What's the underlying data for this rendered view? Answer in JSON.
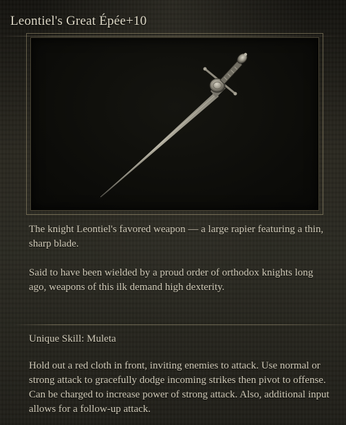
{
  "item": {
    "name": "Leontiel's Great Épée+10",
    "image_icon": "great-epee-weapon-icon"
  },
  "description": {
    "paragraph_1": "The knight Leontiel's favored weapon — a large rapier featuring a thin, sharp blade.",
    "paragraph_2": "Said to have been wielded by a proud order of orthodox knights long ago, weapons of this ilk demand high dexterity."
  },
  "skill": {
    "name": "Unique Skill: Muleta",
    "description": "Hold out a red cloth in front, inviting enemies to attack. Use normal or strong attack to gracefully dodge incoming strikes then pivot to offense. Can be charged to increase power of strong attack. Also, additional input allows for a follow-up attack."
  },
  "colors": {
    "text": "#cfc9b7",
    "title": "#ddd8c6",
    "frame": "#a69b78",
    "background": "#2a2820"
  }
}
